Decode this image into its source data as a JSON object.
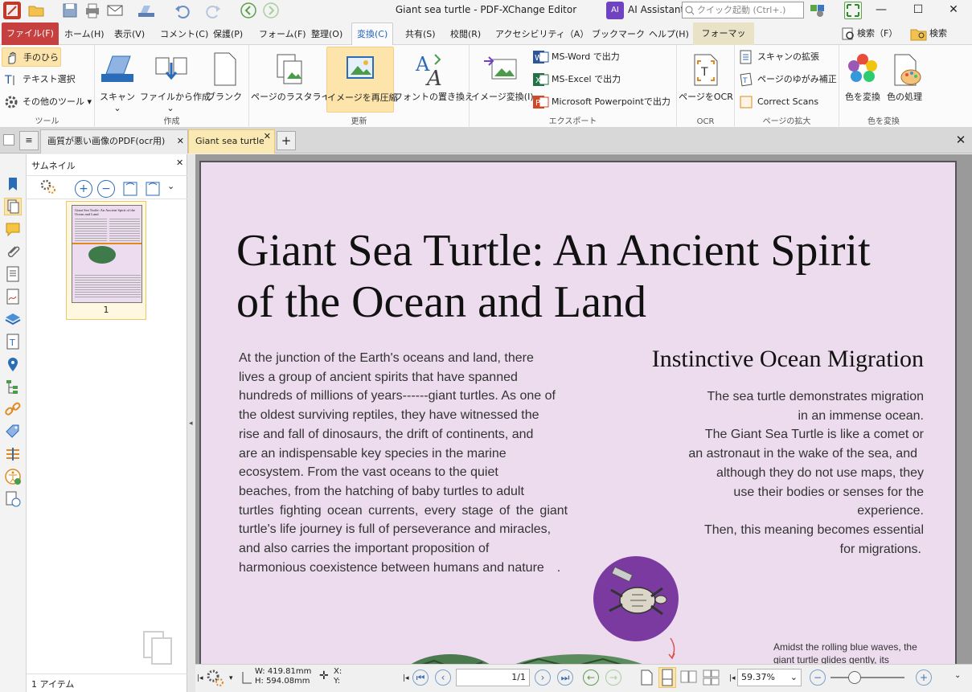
{
  "window": {
    "title": "Giant sea turtle - PDF-XChange Editor"
  },
  "titlebar": {
    "ai_label": "AI Assistant",
    "quick_search_placeholder": "クイック起動 (Ctrl+.)",
    "minimize": "—",
    "maximize": "☐",
    "close": "✕"
  },
  "menubar": {
    "items": [
      "ファイル(F)",
      "ホーム(H)",
      "表示(V)",
      "コメント(C)",
      "保護(P)",
      "フォーム(F)",
      "整理(O)",
      "変換(C)",
      "共有(S)",
      "校閲(R)",
      "アクセシビリティ（A）",
      "ブックマーク",
      "ヘルプ(H)",
      "フォーマット"
    ],
    "search1": "検索（F）",
    "search2": "検索"
  },
  "ribbon": {
    "tools": {
      "hand": "手のひら",
      "text_select": "テキスト選択",
      "other_tools": "その他のツール",
      "group": "ツール"
    },
    "create": {
      "scan": "スキャン",
      "from_file": "ファイルから作成",
      "blank": "ブランク",
      "group": "作成"
    },
    "update": {
      "rasterize": "ページのラスタライズ",
      "recompress": "イメージを再圧縮",
      "font_replace": "フォントの置き換え",
      "group": "更新"
    },
    "export": {
      "image_convert": "イメージ変換(I)",
      "word": "MS-Word で出力",
      "excel": "MS-Excel で出力",
      "ppt": "Microsoft Powerpointで出力",
      "group": "エクスポート"
    },
    "ocr": {
      "page_ocr": "ページをOCR",
      "group": "OCR"
    },
    "page_enhance": {
      "scan_expand": "スキャンの拡張",
      "deskew": "ページのゆがみ補正",
      "correct_scans": "Correct Scans",
      "group": "ページの拡大"
    },
    "color": {
      "convert": "色を変換",
      "process": "色の処理",
      "group": "色を変換"
    }
  },
  "tabs": {
    "doc1": "画質が悪い画像のPDF(ocr用)",
    "doc2": "Giant sea turtle",
    "add": "+",
    "close_all": "✕"
  },
  "thumbnails": {
    "title": "サムネイル",
    "page_label": "1",
    "count": "1 アイテム",
    "mini_title": "Giant Sea Turtle: An Ancient Spirit of the Ocean and Land"
  },
  "document": {
    "title_line1": "Giant Sea Turtle: An Ancient Spirit",
    "title_line2": "of the Ocean and Land",
    "body_lines": [
      "At the junction of the Earth's oceans and land, there",
      "lives a group of ancient spirits that have spanned",
      "hundreds of millions of years------giant turtles. As one of",
      "the oldest surviving reptiles, they have witnessed the",
      "rise and fall of dinosaurs, the drift of continents, and",
      "are an indispensable key species in the marine",
      "ecosystem. From the vast oceans to the quiet",
      "beaches, from the hatching of baby turtles to adult",
      "turtles fighting ocean currents, every stage of the giant",
      "turtle's life journey is full of perseverance and miracles,",
      "and also carries the important proposition of",
      "harmonious coexistence between humans and nature"
    ],
    "body_period": ".",
    "section_heading": "Instinctive Ocean Migration",
    "right_lines": [
      "The sea turtle demonstrates migration",
      "in an immense ocean.",
      "The Giant Sea Turtle is like a comet or",
      "an astronaut in the wake of the sea, and",
      "although they do not use maps, they",
      "use their bodies or senses for the",
      "experience.",
      "Then, this meaning becomes essential",
      "for migrations."
    ],
    "caption_lines": [
      "Amidst the rolling blue waves, the",
      "giant turtle glides gently, its"
    ]
  },
  "statusbar": {
    "width": "W: 419.81mm",
    "height": "H: 594.08mm",
    "x": "X:",
    "y": "Y:",
    "page": "1/1",
    "zoom": "59.37%"
  }
}
